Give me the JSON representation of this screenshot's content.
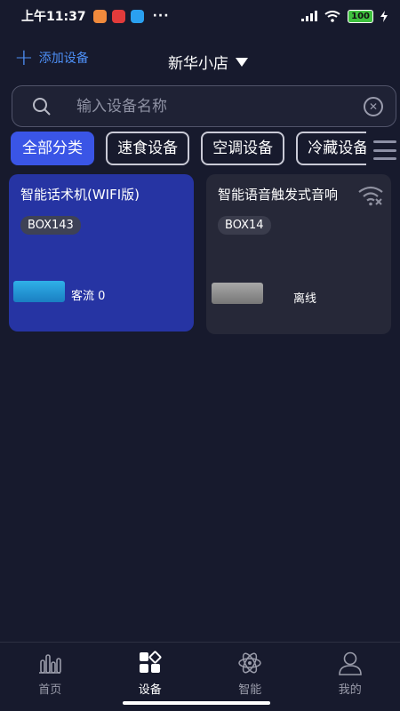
{
  "status_bar": {
    "time": "上午11:37",
    "more": "···",
    "battery": "100"
  },
  "header": {
    "add_label": "添加设备",
    "store_name": "新华小店"
  },
  "search": {
    "placeholder": "输入设备名称"
  },
  "categories": [
    "全部分类",
    "速食设备",
    "空调设备",
    "冷藏设备"
  ],
  "active_category": "全部分类",
  "devices": [
    {
      "name": "智能话术机(WIFI版)",
      "tag": "BOX143",
      "status": "客流 0",
      "online": true
    },
    {
      "name": "智能语音触发式音响",
      "tag": "BOX14",
      "status": "离线",
      "online": false
    }
  ],
  "tabs": [
    {
      "label": "首页",
      "icon": "bar-chart-icon",
      "active": false
    },
    {
      "label": "设备",
      "icon": "devices-grid-icon",
      "active": true
    },
    {
      "label": "智能",
      "icon": "atom-icon",
      "active": false
    },
    {
      "label": "我的",
      "icon": "user-icon",
      "active": false
    }
  ],
  "colors": {
    "background": "#171a2d",
    "accent": "#3a55e6",
    "link": "#4d8ff5",
    "card_online": "#2634a3",
    "card_offline": "#262838"
  }
}
